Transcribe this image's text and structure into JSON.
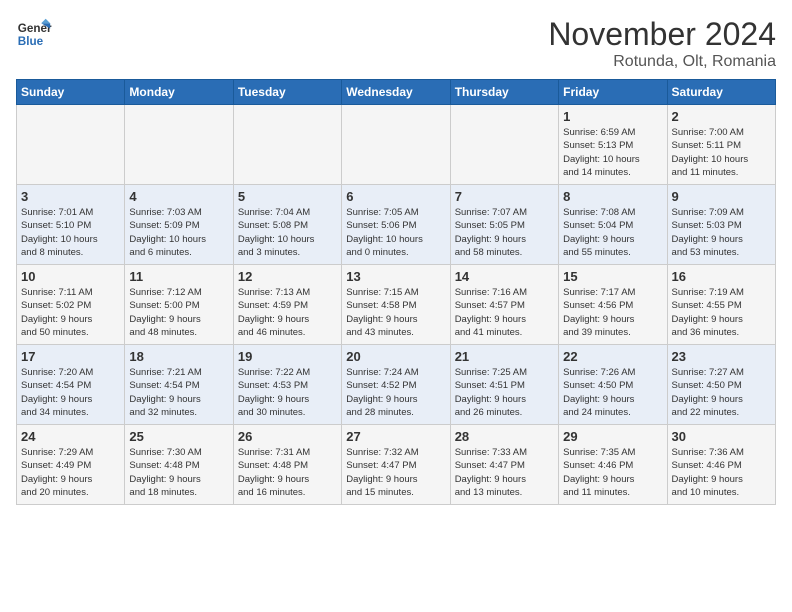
{
  "logo": {
    "line1": "General",
    "line2": "Blue"
  },
  "title": "November 2024",
  "location": "Rotunda, Olt, Romania",
  "days_of_week": [
    "Sunday",
    "Monday",
    "Tuesday",
    "Wednesday",
    "Thursday",
    "Friday",
    "Saturday"
  ],
  "weeks": [
    [
      {
        "day": "",
        "info": ""
      },
      {
        "day": "",
        "info": ""
      },
      {
        "day": "",
        "info": ""
      },
      {
        "day": "",
        "info": ""
      },
      {
        "day": "",
        "info": ""
      },
      {
        "day": "1",
        "info": "Sunrise: 6:59 AM\nSunset: 5:13 PM\nDaylight: 10 hours\nand 14 minutes."
      },
      {
        "day": "2",
        "info": "Sunrise: 7:00 AM\nSunset: 5:11 PM\nDaylight: 10 hours\nand 11 minutes."
      }
    ],
    [
      {
        "day": "3",
        "info": "Sunrise: 7:01 AM\nSunset: 5:10 PM\nDaylight: 10 hours\nand 8 minutes."
      },
      {
        "day": "4",
        "info": "Sunrise: 7:03 AM\nSunset: 5:09 PM\nDaylight: 10 hours\nand 6 minutes."
      },
      {
        "day": "5",
        "info": "Sunrise: 7:04 AM\nSunset: 5:08 PM\nDaylight: 10 hours\nand 3 minutes."
      },
      {
        "day": "6",
        "info": "Sunrise: 7:05 AM\nSunset: 5:06 PM\nDaylight: 10 hours\nand 0 minutes."
      },
      {
        "day": "7",
        "info": "Sunrise: 7:07 AM\nSunset: 5:05 PM\nDaylight: 9 hours\nand 58 minutes."
      },
      {
        "day": "8",
        "info": "Sunrise: 7:08 AM\nSunset: 5:04 PM\nDaylight: 9 hours\nand 55 minutes."
      },
      {
        "day": "9",
        "info": "Sunrise: 7:09 AM\nSunset: 5:03 PM\nDaylight: 9 hours\nand 53 minutes."
      }
    ],
    [
      {
        "day": "10",
        "info": "Sunrise: 7:11 AM\nSunset: 5:02 PM\nDaylight: 9 hours\nand 50 minutes."
      },
      {
        "day": "11",
        "info": "Sunrise: 7:12 AM\nSunset: 5:00 PM\nDaylight: 9 hours\nand 48 minutes."
      },
      {
        "day": "12",
        "info": "Sunrise: 7:13 AM\nSunset: 4:59 PM\nDaylight: 9 hours\nand 46 minutes."
      },
      {
        "day": "13",
        "info": "Sunrise: 7:15 AM\nSunset: 4:58 PM\nDaylight: 9 hours\nand 43 minutes."
      },
      {
        "day": "14",
        "info": "Sunrise: 7:16 AM\nSunset: 4:57 PM\nDaylight: 9 hours\nand 41 minutes."
      },
      {
        "day": "15",
        "info": "Sunrise: 7:17 AM\nSunset: 4:56 PM\nDaylight: 9 hours\nand 39 minutes."
      },
      {
        "day": "16",
        "info": "Sunrise: 7:19 AM\nSunset: 4:55 PM\nDaylight: 9 hours\nand 36 minutes."
      }
    ],
    [
      {
        "day": "17",
        "info": "Sunrise: 7:20 AM\nSunset: 4:54 PM\nDaylight: 9 hours\nand 34 minutes."
      },
      {
        "day": "18",
        "info": "Sunrise: 7:21 AM\nSunset: 4:54 PM\nDaylight: 9 hours\nand 32 minutes."
      },
      {
        "day": "19",
        "info": "Sunrise: 7:22 AM\nSunset: 4:53 PM\nDaylight: 9 hours\nand 30 minutes."
      },
      {
        "day": "20",
        "info": "Sunrise: 7:24 AM\nSunset: 4:52 PM\nDaylight: 9 hours\nand 28 minutes."
      },
      {
        "day": "21",
        "info": "Sunrise: 7:25 AM\nSunset: 4:51 PM\nDaylight: 9 hours\nand 26 minutes."
      },
      {
        "day": "22",
        "info": "Sunrise: 7:26 AM\nSunset: 4:50 PM\nDaylight: 9 hours\nand 24 minutes."
      },
      {
        "day": "23",
        "info": "Sunrise: 7:27 AM\nSunset: 4:50 PM\nDaylight: 9 hours\nand 22 minutes."
      }
    ],
    [
      {
        "day": "24",
        "info": "Sunrise: 7:29 AM\nSunset: 4:49 PM\nDaylight: 9 hours\nand 20 minutes."
      },
      {
        "day": "25",
        "info": "Sunrise: 7:30 AM\nSunset: 4:48 PM\nDaylight: 9 hours\nand 18 minutes."
      },
      {
        "day": "26",
        "info": "Sunrise: 7:31 AM\nSunset: 4:48 PM\nDaylight: 9 hours\nand 16 minutes."
      },
      {
        "day": "27",
        "info": "Sunrise: 7:32 AM\nSunset: 4:47 PM\nDaylight: 9 hours\nand 15 minutes."
      },
      {
        "day": "28",
        "info": "Sunrise: 7:33 AM\nSunset: 4:47 PM\nDaylight: 9 hours\nand 13 minutes."
      },
      {
        "day": "29",
        "info": "Sunrise: 7:35 AM\nSunset: 4:46 PM\nDaylight: 9 hours\nand 11 minutes."
      },
      {
        "day": "30",
        "info": "Sunrise: 7:36 AM\nSunset: 4:46 PM\nDaylight: 9 hours\nand 10 minutes."
      }
    ]
  ]
}
